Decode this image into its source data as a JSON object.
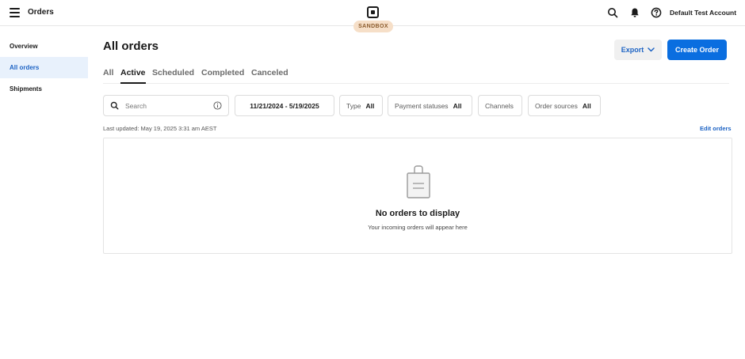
{
  "header": {
    "app_title": "Orders",
    "badge": "SANDBOX",
    "account": "Default Test Account",
    "icons": [
      "menu-icon",
      "square-logo-icon",
      "search-icon",
      "bell-icon",
      "help-icon"
    ]
  },
  "sidebar": {
    "items": [
      {
        "label": "Overview",
        "active": false
      },
      {
        "label": "All orders",
        "active": true
      },
      {
        "label": "Shipments",
        "active": false
      }
    ]
  },
  "main": {
    "title": "All orders",
    "export_label": "Export",
    "create_label": "Create Order",
    "tabs": [
      {
        "label": "All",
        "active": false
      },
      {
        "label": "Active",
        "active": true
      },
      {
        "label": "Scheduled",
        "active": false
      },
      {
        "label": "Completed",
        "active": false
      },
      {
        "label": "Canceled",
        "active": false
      }
    ],
    "filters": {
      "search_placeholder": "Search",
      "date_range": "11/21/2024 - 5/19/2025",
      "type_label": "Type",
      "type_value": "All",
      "payment_label": "Payment statuses",
      "payment_value": "All",
      "channels_label": "Channels",
      "sources_label": "Order sources",
      "sources_value": "All"
    },
    "last_updated": "Last updated: May 19, 2025 3:31 am AEST",
    "edit_orders": "Edit orders",
    "empty": {
      "title": "No orders to display",
      "subtitle": "Your incoming orders will appear here"
    }
  },
  "colors": {
    "accent": "#0a6ee0",
    "link": "#1d63c4",
    "sidebar_active_bg": "#e8f1fc",
    "sandbox_bg": "#f6dfc8"
  }
}
